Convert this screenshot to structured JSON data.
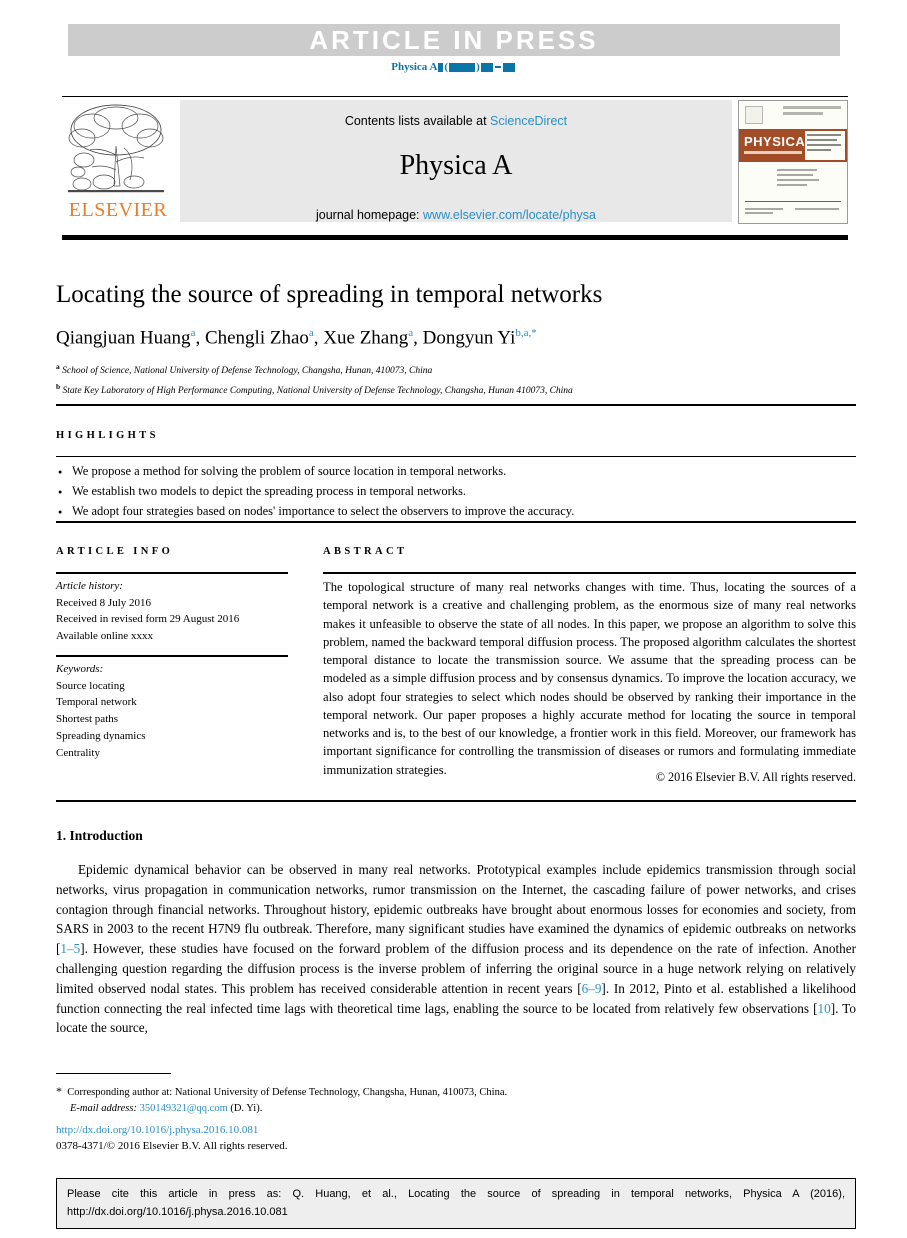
{
  "banner": {
    "article_in_press": "ARTICLE  IN  PRESS",
    "running_head_journal": "Physica A"
  },
  "masthead": {
    "contents_prefix": "Contents lists available at ",
    "contents_link": "ScienceDirect",
    "journal_title": "Physica A",
    "homepage_prefix": "journal homepage: ",
    "homepage_link": "www.elsevier.com/locate/physa",
    "publisher": "ELSEVIER",
    "cover_label": "PHYSICA",
    "cover_subtitle": "A STATISTICAL MECHANICS AND ITS APPLICATIONS"
  },
  "article": {
    "title": "Locating the source of spreading in temporal networks",
    "authors": [
      {
        "name": "Qiangjuan Huang",
        "sup": "a"
      },
      {
        "name": "Chengli Zhao",
        "sup": "a"
      },
      {
        "name": "Xue Zhang",
        "sup": "a"
      },
      {
        "name": "Dongyun Yi",
        "sup": "b,a,*"
      }
    ],
    "affiliations": [
      {
        "marker": "a",
        "text": "School of Science, National University of Defense Technology, Changsha, Hunan, 410073, China"
      },
      {
        "marker": "b",
        "text": "State Key Laboratory of High Performance Computing, National University of Defense Technology, Changsha, Hunan 410073, China"
      }
    ]
  },
  "highlights": {
    "heading": "HIGHLIGHTS",
    "items": [
      "We propose a method for solving the problem of source location in temporal networks.",
      "We establish two models to depict the spreading process in temporal networks.",
      "We adopt four strategies based on nodes' importance to select the observers to improve the accuracy."
    ]
  },
  "article_info": {
    "heading": "ARTICLE INFO",
    "history_label": "Article history:",
    "history": [
      "Received 8 July 2016",
      "Received in revised form 29 August 2016",
      "Available online xxxx"
    ],
    "keywords_label": "Keywords:",
    "keywords": [
      "Source locating",
      "Temporal network",
      "Shortest paths",
      "Spreading dynamics",
      "Centrality"
    ]
  },
  "abstract": {
    "heading": "ABSTRACT",
    "text": "The topological structure of many real networks changes with time. Thus, locating the sources of a temporal network is a creative and challenging problem, as the enormous size of many real networks makes it unfeasible to observe the state of all nodes. In this paper, we propose an algorithm to solve this problem, named the backward temporal diffusion process. The proposed algorithm calculates the shortest temporal distance to locate the transmission source. We assume that the spreading process can be modeled as a simple diffusion process and by consensus dynamics. To improve the location accuracy, we also adopt four strategies to select which nodes should be observed by ranking their importance in the temporal network. Our paper proposes a highly accurate method for locating the source in temporal networks and is, to the best of our knowledge, a frontier work in this field. Moreover, our framework has important significance for controlling the transmission of diseases or rumors and formulating immediate immunization strategies.",
    "copyright": "© 2016 Elsevier B.V. All rights reserved."
  },
  "introduction": {
    "heading": "1. Introduction",
    "paragraph_parts": [
      {
        "type": "text",
        "value": "Epidemic dynamical behavior can be observed in many real networks. Prototypical examples include epidemics transmission through social networks, virus propagation in communication networks, rumor transmission on the Internet, the cascading failure of power networks, and crises contagion through financial networks. Throughout history, epidemic outbreaks have brought about enormous losses for economies and society, from SARS in 2003 to the recent H7N9 flu outbreak. Therefore, many significant studies have examined the dynamics of epidemic outbreaks on networks ["
      },
      {
        "type": "link",
        "value": "1–5"
      },
      {
        "type": "text",
        "value": "]. However, these studies have focused on the forward problem of the diffusion process and its dependence on the rate of infection. Another challenging question regarding the diffusion process is the inverse problem of inferring the original source in a huge network relying on relatively limited observed nodal states. This problem has received considerable attention in recent years ["
      },
      {
        "type": "link",
        "value": "6–9"
      },
      {
        "type": "text",
        "value": "]. In 2012, Pinto et al. established a likelihood function connecting the real infected time lags with theoretical time lags, enabling the source to be located from relatively few observations ["
      },
      {
        "type": "link",
        "value": "10"
      },
      {
        "type": "text",
        "value": "]. To locate the source,"
      }
    ]
  },
  "footnote": {
    "corresponding": "Corresponding author at: National University of Defense Technology, Changsha, Hunan, 410073, China.",
    "email_label": "E-mail address:",
    "email": "350149321@qq.com",
    "email_suffix": "(D. Yi).",
    "doi": "http://dx.doi.org/10.1016/j.physa.2016.10.081",
    "issn": "0378-4371/© 2016 Elsevier B.V. All rights reserved."
  },
  "cite_box": {
    "line1": "Please cite this article in press as: Q. Huang, et al., Locating the source of spreading in temporal networks, Physica A (2016),",
    "line2": "http://dx.doi.org/10.1016/j.physa.2016.10.081"
  },
  "colors": {
    "link": "#2b8fc4",
    "running_head": "#0a76a8",
    "elsevier_orange": "#ec7c26",
    "banner_gray": "#cccccc"
  }
}
